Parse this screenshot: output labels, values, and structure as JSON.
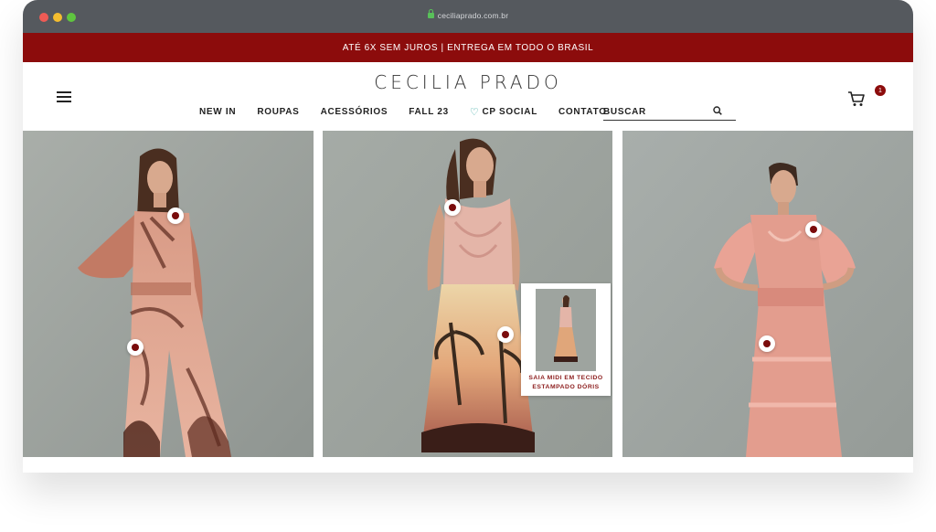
{
  "browser": {
    "url": "ceciliaprado.com.br",
    "lock_icon": "lock-icon"
  },
  "promo_bar": {
    "text": "ATÉ 6X SEM JUROS | ENTREGA EM TODO O BRASIL",
    "background": "#8c0c0c"
  },
  "header": {
    "logo": "CECILIA PRADO",
    "menu_icon": "hamburger-icon",
    "nav": [
      {
        "label": "NEW IN"
      },
      {
        "label": "ROUPAS"
      },
      {
        "label": "ACESSÓRIOS"
      },
      {
        "label": "FALL 23"
      },
      {
        "label": "CP SOCIAL",
        "icon": "heart-icon"
      },
      {
        "label": "CONTATO"
      }
    ],
    "search": {
      "placeholder": "BUSCAR",
      "icon": "search-icon"
    },
    "cart": {
      "icon": "cart-icon",
      "count": "1"
    }
  },
  "products": [
    {
      "hotspots": 2
    },
    {
      "hotspots": 2,
      "card": {
        "caption_line1": "SAIA MIDI EM TECIDO",
        "caption_line2": "ESTAMPADO DÓRIS"
      }
    },
    {
      "hotspots": 2
    }
  ],
  "colors": {
    "accent": "#8c0c0c",
    "hotspot_dot": "#7a0c0c",
    "cp_social_heart": "#2aa19a"
  }
}
